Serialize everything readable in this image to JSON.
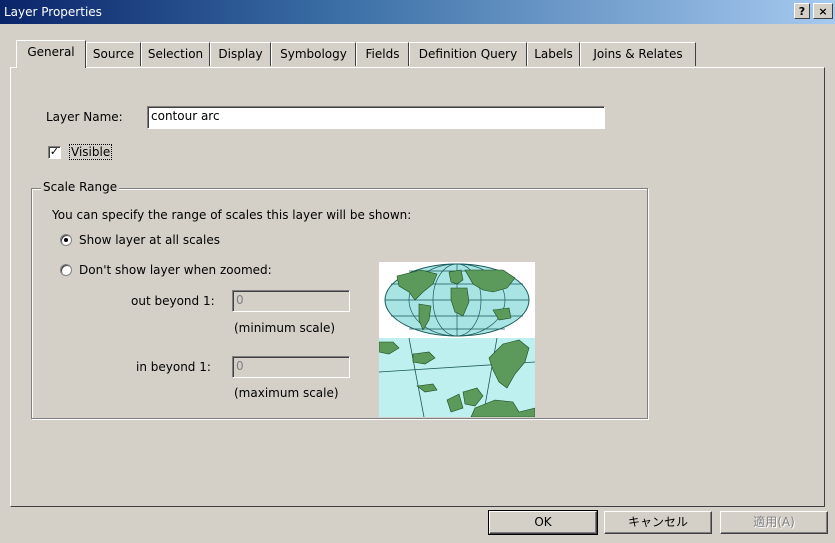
{
  "window": {
    "title": "Layer Properties",
    "help_label": "?",
    "close_label": "×"
  },
  "tabs": [
    {
      "label": "General"
    },
    {
      "label": "Source"
    },
    {
      "label": "Selection"
    },
    {
      "label": "Display"
    },
    {
      "label": "Symbology"
    },
    {
      "label": "Fields"
    },
    {
      "label": "Definition Query"
    },
    {
      "label": "Labels"
    },
    {
      "label": "Joins & Relates"
    }
  ],
  "general": {
    "layer_name_label": "Layer Name:",
    "layer_name_value": "contour arc",
    "visible_label": "Visible",
    "visible_checked": true
  },
  "scale_range": {
    "group_label": "Scale Range",
    "description": "You can specify the range of scales this layer will be shown:",
    "option_all": "Show layer at all scales",
    "option_zoomed": "Don't show layer when zoomed:",
    "selected": "all",
    "out_beyond_label": "out beyond 1:",
    "out_beyond_value": "0",
    "min_caption": "(minimum scale)",
    "in_beyond_label": "in beyond 1:",
    "in_beyond_value": "0",
    "max_caption": "(maximum scale)"
  },
  "buttons": {
    "ok": "OK",
    "cancel": "キャンセル",
    "apply": "適用(A)"
  }
}
